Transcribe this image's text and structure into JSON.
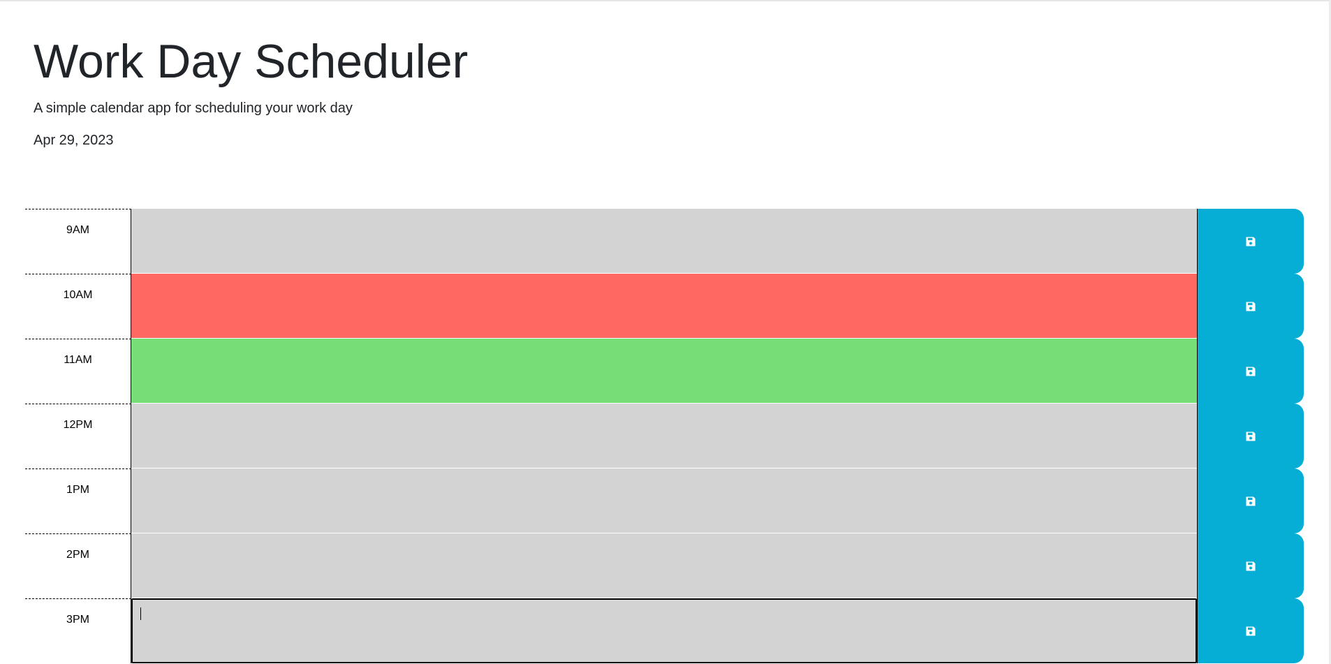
{
  "header": {
    "title": "Work Day Scheduler",
    "lead": "A simple calendar app for scheduling your work day",
    "current_day": "Apr 29, 2023"
  },
  "colors": {
    "past": "#d3d3d3",
    "present": "#ff6961",
    "future": "#77dd77",
    "save_button": "#06aed5"
  },
  "timeblocks": [
    {
      "hour": "9AM",
      "state": "past",
      "text": ""
    },
    {
      "hour": "10AM",
      "state": "present",
      "text": ""
    },
    {
      "hour": "11AM",
      "state": "future",
      "text": ""
    },
    {
      "hour": "12PM",
      "state": "past",
      "text": ""
    },
    {
      "hour": "1PM",
      "state": "past",
      "text": ""
    },
    {
      "hour": "2PM",
      "state": "past",
      "text": ""
    },
    {
      "hour": "3PM",
      "state": "past",
      "text": ""
    }
  ],
  "save_icon": "floppy-disk-icon"
}
